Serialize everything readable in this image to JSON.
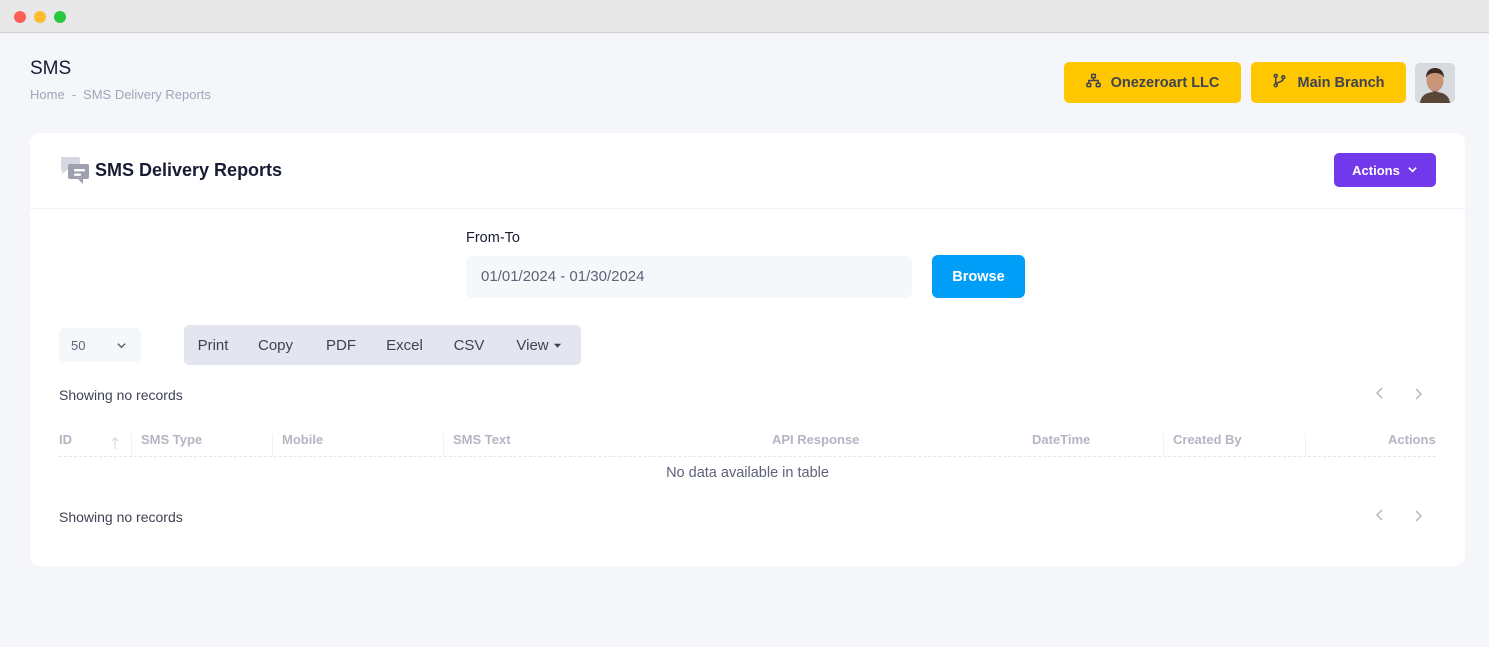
{
  "window": {
    "controls": [
      "close",
      "minimize",
      "maximize"
    ]
  },
  "header": {
    "title": "SMS",
    "breadcrumb": {
      "home": "Home",
      "separator": "-",
      "current": "SMS Delivery Reports"
    },
    "company_button": {
      "label": "Onezeroart LLC",
      "icon": "sitemap-icon"
    },
    "branch_button": {
      "label": "Main Branch",
      "icon": "code-branch-icon"
    },
    "avatar": {
      "icon": "user-avatar"
    }
  },
  "card": {
    "title": "SMS Delivery Reports",
    "icon": "chat-messages-icon",
    "actions_label": "Actions"
  },
  "filter": {
    "label": "From-To",
    "date_range": "01/01/2024 - 01/30/2024",
    "browse_label": "Browse"
  },
  "table_controls": {
    "page_size": "50",
    "export_buttons": [
      "Print",
      "Copy",
      "PDF",
      "Excel",
      "CSV",
      "View"
    ]
  },
  "table": {
    "info_top": "Showing no records",
    "info_bottom": "Showing no records",
    "columns": [
      "ID",
      "SMS Type",
      "Mobile",
      "SMS Text",
      "API Response",
      "DateTime",
      "Created By",
      "Actions"
    ],
    "empty_message": "No data available in table"
  },
  "colors": {
    "accent_yellow": "#ffc700",
    "actions_purple": "#7239ea",
    "browse_blue": "#009ef7",
    "page_bg": "#f4f6f9"
  }
}
